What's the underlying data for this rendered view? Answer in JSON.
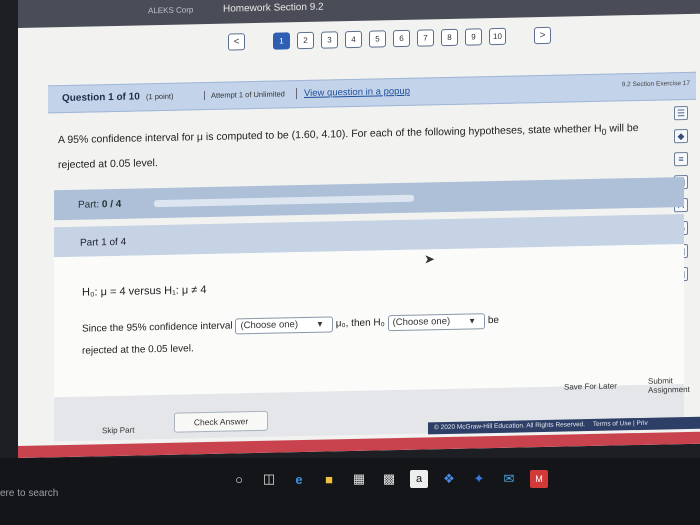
{
  "window": {
    "brand": "ALEKS Corp",
    "title": "Homework Section 9.2"
  },
  "pager": {
    "prev_icon": "chevron-left-icon",
    "next_icon": "chevron-right-icon",
    "prev": "<",
    "next": ">",
    "pages": [
      "1",
      "2",
      "3",
      "4",
      "5",
      "6",
      "7",
      "8",
      "9",
      "10"
    ],
    "current": "1"
  },
  "question_bar": {
    "number": "Question 1 of 10",
    "points": "(1 point)",
    "attempts": "Attempt 1 of Unlimited",
    "popup_link": "View question in a popup",
    "exercise": "9.2 Section Exercise 17"
  },
  "question": {
    "line1": "A 95% confidence interval for μ is computed to be (1.60, 4.10). For each of the following hypotheses, state whether H",
    "h_sub": "0",
    "line1_end": " will be",
    "line2": "rejected at 0.05 level."
  },
  "part": {
    "label": "Part:",
    "progress_text": "0 / 4",
    "progress_fraction": 0,
    "sub_label": "Part 1 of 4"
  },
  "work": {
    "hypothesis": "H₀: μ = 4 versus H₁: μ ≠ 4",
    "sentence_a": "Since the 95% confidence interval",
    "dropdown1": "(Choose one)",
    "sentence_b": "μ₀, then H₀",
    "dropdown2": "(Choose one)",
    "sentence_c": "be",
    "sentence_d": "rejected at the 0.05 level."
  },
  "footer": {
    "skip": "Skip Part",
    "check": "Check Answer",
    "save": "Save For Later",
    "submit": "Submit Assignment"
  },
  "copyright": "© 2020 McGraw-Hill Education. All Rights Reserved.",
  "copyright_links": "Terms of Use | Priv",
  "taskbar": {
    "search_placeholder": "ere to search"
  },
  "tool_icons": [
    "book-icon",
    "diamond-icon",
    "list-icon",
    "calculator-icon",
    "glossary-icon",
    "print-icon",
    "chart-icon",
    "table-icon"
  ],
  "taskbar_icons": [
    "task-view-icon",
    "edge-icon",
    "file-explorer-icon",
    "store-icon",
    "amazon-icon",
    "dropbox-icon",
    "app-icon",
    "mail-icon",
    "mcafee-icon"
  ]
}
